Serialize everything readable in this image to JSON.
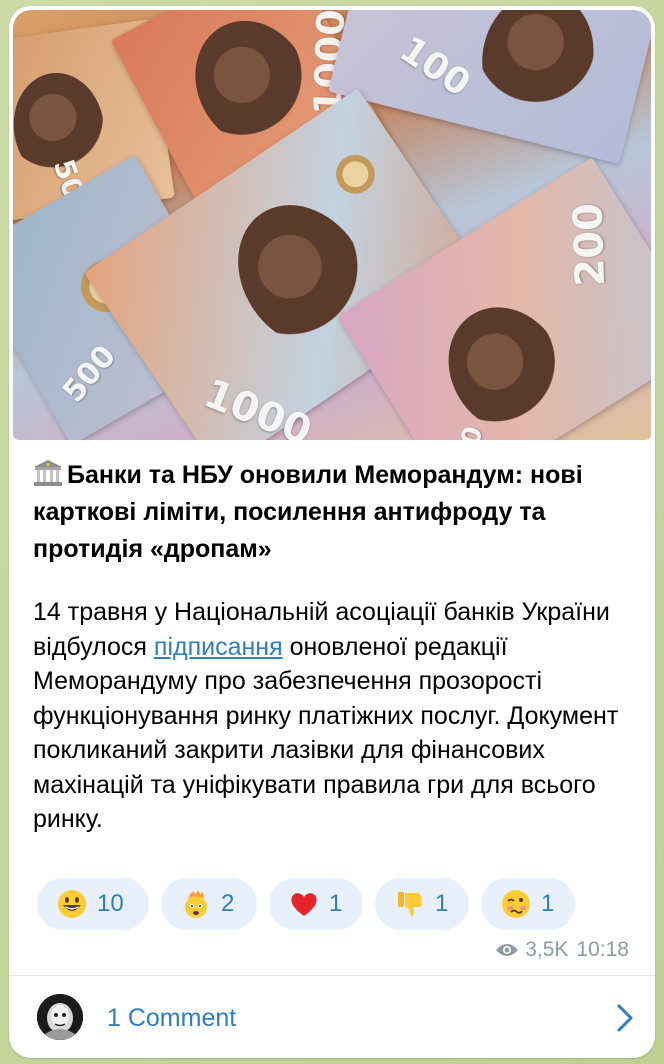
{
  "post": {
    "title": "Банки та НБУ оновили Меморандум: нові карткові ліміти, посилення антифроду та протидія «дропам»",
    "body_before_link": "14 травня у Національній асоціації банків України відбулося ",
    "link_text": "підписання",
    "body_after_link": " оновленої редакції Меморандуму про забезпечення прозорості функціонування ринку платіжних послуг. Документ покликаний закрити лазівки для фінансових махінацій та уніфікувати правила гри для всього ринку."
  },
  "photo": {
    "banknote_numerals": [
      "1000",
      "500",
      "100",
      "200"
    ]
  },
  "reactions": [
    {
      "icon": "grinning-face-icon",
      "count": "10"
    },
    {
      "icon": "exploding-head-icon",
      "count": "2"
    },
    {
      "icon": "red-heart-icon",
      "count": "1"
    },
    {
      "icon": "thumbs-down-icon",
      "count": "1"
    },
    {
      "icon": "woozy-face-icon",
      "count": "1"
    }
  ],
  "meta": {
    "views": "3,5K",
    "time": "10:18"
  },
  "comments": {
    "label": "1 Comment"
  },
  "colors": {
    "accent": "#2f7ec1",
    "reaction_bg": "#e8f1fb",
    "chat_bg": "#c9d7a4"
  }
}
